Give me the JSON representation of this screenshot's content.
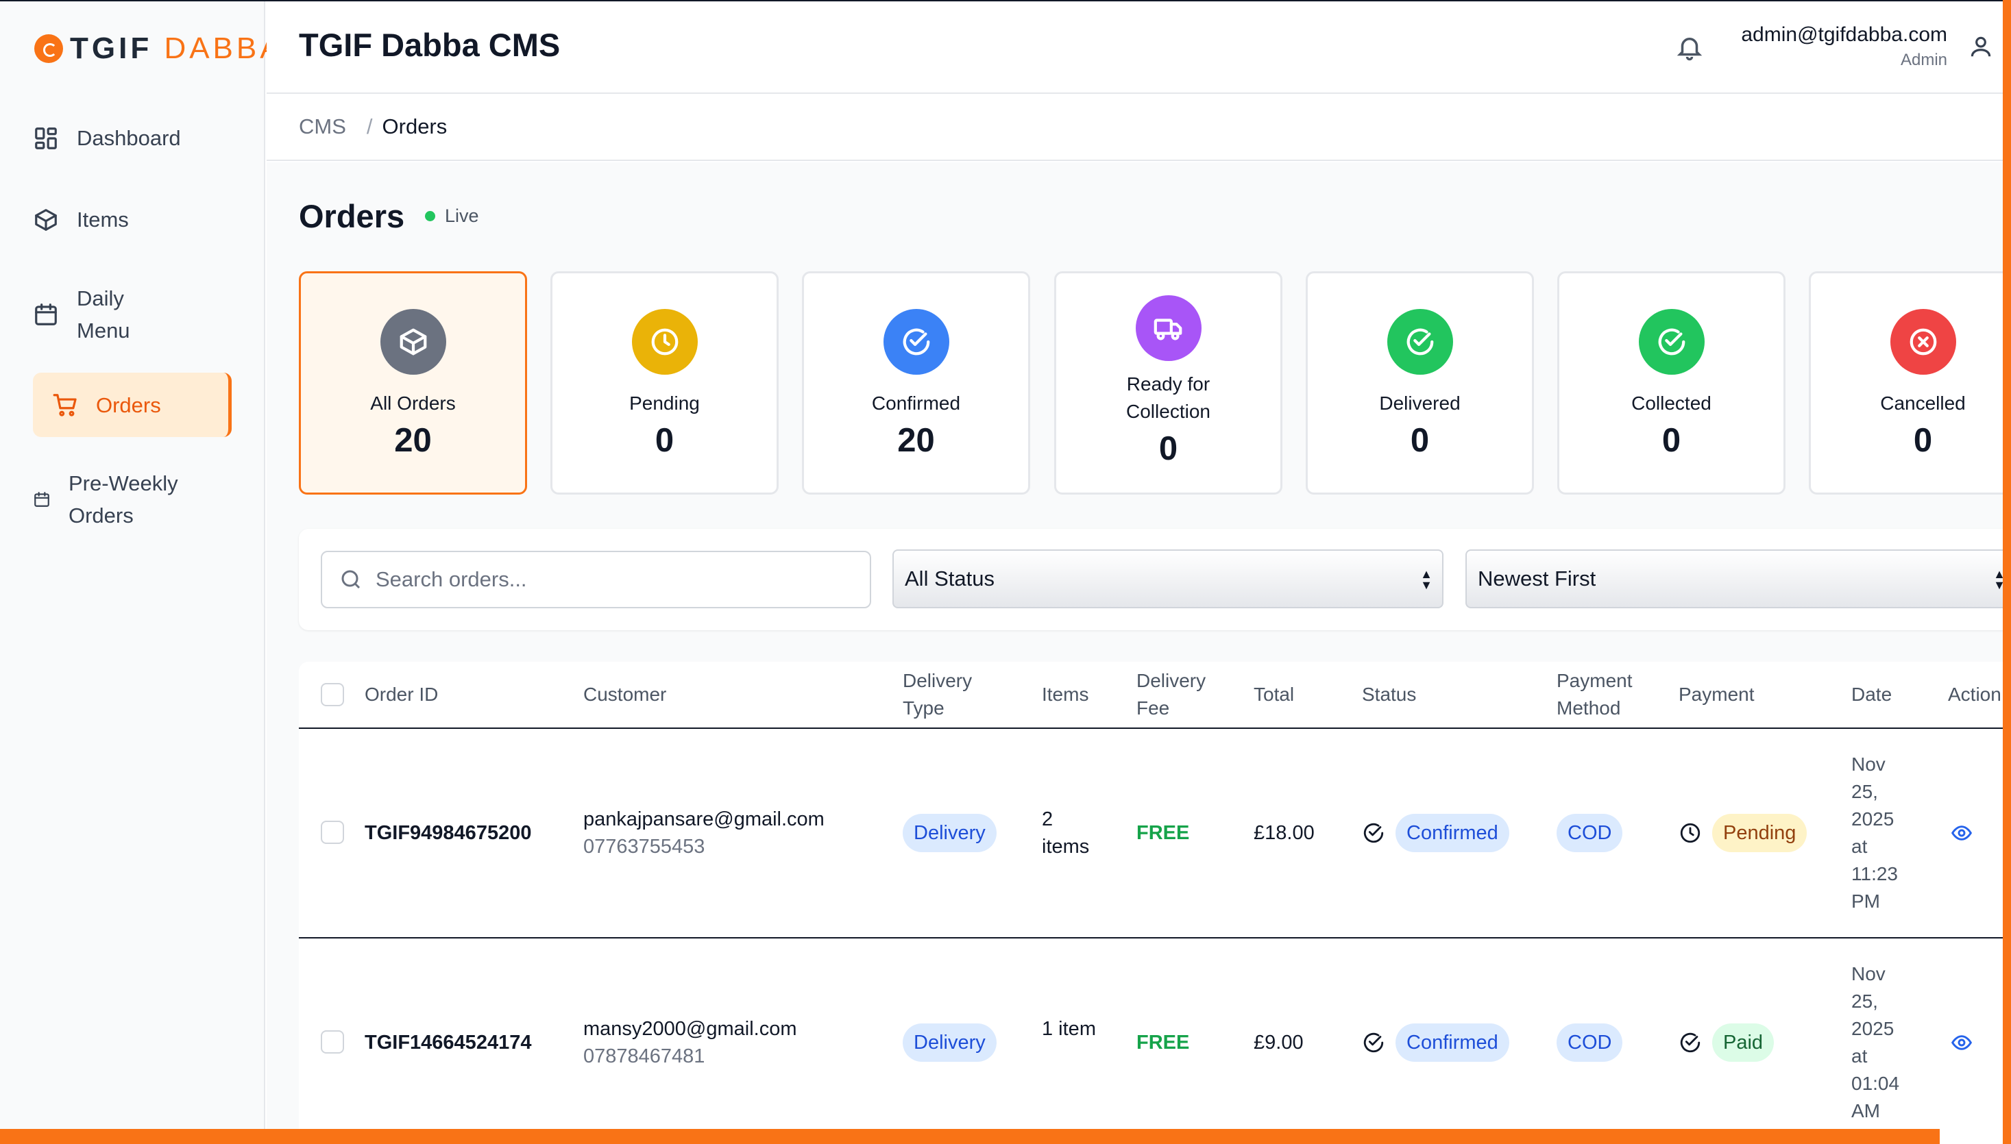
{
  "brand": {
    "logo_main": "TGIF",
    "logo_accent": "DABBA",
    "accent_color": "#f97316"
  },
  "sidebar": {
    "items": [
      {
        "label": "Dashboard",
        "icon": "dashboard-grid-icon"
      },
      {
        "label": "Items",
        "icon": "box-icon"
      },
      {
        "label": "Daily Menu",
        "icon": "calendar-icon"
      },
      {
        "label": "Orders",
        "icon": "cart-icon",
        "active": true
      },
      {
        "label": "Pre-Weekly Orders",
        "icon": "calendar-small-icon"
      }
    ]
  },
  "header": {
    "title": "TGIF Dabba CMS",
    "user_email": "admin@tgifdabba.com",
    "user_role": "Admin"
  },
  "breadcrumb": {
    "root": "CMS",
    "separator": "/",
    "current": "Orders"
  },
  "page": {
    "title": "Orders",
    "live_label": "Live"
  },
  "stats": [
    {
      "label": "All Orders",
      "value": "20",
      "color": "#6b7280",
      "icon": "box-icon"
    },
    {
      "label": "Pending",
      "value": "0",
      "color": "#eab308",
      "icon": "clock-icon"
    },
    {
      "label": "Confirmed",
      "value": "20",
      "color": "#3b82f6",
      "icon": "check-circle-icon"
    },
    {
      "label": "Ready for Collection",
      "value": "0",
      "color": "#a855f7",
      "icon": "truck-icon"
    },
    {
      "label": "Delivered",
      "value": "0",
      "color": "#22c55e",
      "icon": "check-circle-icon"
    },
    {
      "label": "Collected",
      "value": "0",
      "color": "#22c55e",
      "icon": "check-circle-icon"
    },
    {
      "label": "Cancelled",
      "value": "0",
      "color": "#ef4444",
      "icon": "x-circle-icon"
    }
  ],
  "filters": {
    "search_placeholder": "Search orders...",
    "status_selected": "All Status",
    "sort_selected": "Newest First"
  },
  "table": {
    "columns": [
      "Order ID",
      "Customer",
      "Delivery Type",
      "Items",
      "Delivery Fee",
      "Total",
      "Status",
      "Payment Method",
      "Payment",
      "Date",
      "Action"
    ],
    "rows": [
      {
        "order_id": "TGIF94984675200",
        "email": "pankajpansare@gmail.com",
        "phone": "07763755453",
        "delivery_type": "Delivery",
        "items": "2 items",
        "delivery_fee": "FREE",
        "total": "£18.00",
        "status": "Confirmed",
        "payment_method": "COD",
        "payment": "Pending",
        "date": "Nov 25, 2025 at 11:23 PM"
      },
      {
        "order_id": "TGIF14664524174",
        "email": "mansy2000@gmail.com",
        "phone": "07878467481",
        "delivery_type": "Delivery",
        "items": "1 item",
        "delivery_fee": "FREE",
        "total": "£9.00",
        "status": "Confirmed",
        "payment_method": "COD",
        "payment": "Paid",
        "date": "Nov 25, 2025 at 01:04 AM"
      }
    ]
  }
}
